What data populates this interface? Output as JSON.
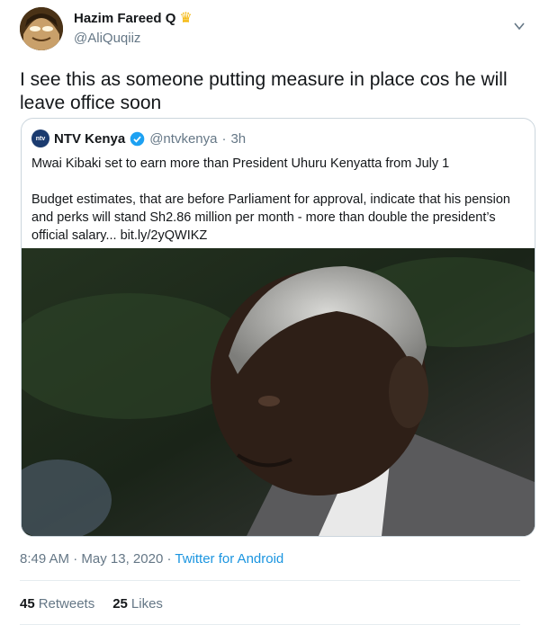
{
  "author": {
    "name": "Hazim Fareed Q",
    "badge_icon": "crown-icon",
    "handle": "@AliQuqiiz",
    "avatar_icon": "cartoon-avatar-icon"
  },
  "tweet": {
    "text": "I see this as someone putting measure in place cos he will leave office soon"
  },
  "quoted": {
    "avatar_label": "ntv",
    "name": "NTV Kenya",
    "verified_icon": "verified-badge-icon",
    "handle": "@ntvkenya",
    "separator": "·",
    "time": "3h",
    "text": "Mwai Kibaki set to earn more than President Uhuru Kenyatta from July 1\n\nBudget estimates, that are before Parliament for approval, indicate that his pension and perks will stand Sh2.86 million per month - more than double the president’s official salary... bit.ly/2yQWIKZ",
    "image_icon": "photo-of-man-icon"
  },
  "meta": {
    "time": "8:49 AM",
    "sep1": "·",
    "date": "May 13, 2020",
    "sep2": "·",
    "source": "Twitter for Android"
  },
  "stats": {
    "retweets_count": "45",
    "retweets_label": "Retweets",
    "likes_count": "25",
    "likes_label": "Likes"
  },
  "colors": {
    "link": "#1b95e0",
    "secondary_text": "#657786",
    "verified": "#1da1f2"
  }
}
